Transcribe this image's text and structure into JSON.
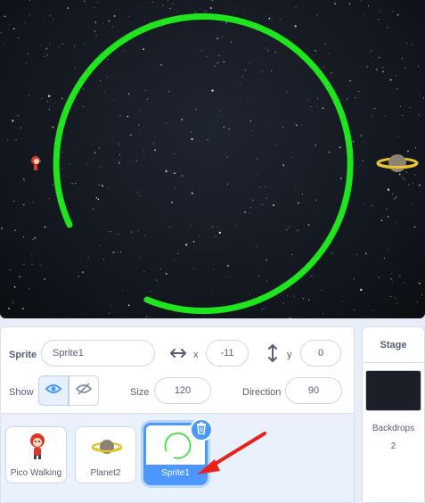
{
  "stage": {
    "sprites": [
      "pico-character",
      "planet-ringed",
      "green-circle-arc"
    ]
  },
  "sprite_info": {
    "sprite_label": "Sprite",
    "sprite_name": "Sprite1",
    "x_label": "x",
    "x_value": "-11",
    "y_label": "y",
    "y_value": "0",
    "show_label": "Show",
    "size_label": "Size",
    "size_value": "120",
    "direction_label": "Direction",
    "direction_value": "90"
  },
  "sprite_list": {
    "items": [
      {
        "name": "Pico Walking",
        "icon": "pico-icon",
        "selected": false
      },
      {
        "name": "Planet2",
        "icon": "planet-icon",
        "selected": false
      },
      {
        "name": "Sprite1",
        "icon": "green-arc-icon",
        "selected": true
      }
    ]
  },
  "stage_panel": {
    "title": "Stage",
    "backdrops_label": "Backdrops",
    "backdrops_count": "2"
  },
  "colors": {
    "accent": "#4c97ff",
    "arc": "#1ee51e",
    "arrow": "#e8231b"
  }
}
